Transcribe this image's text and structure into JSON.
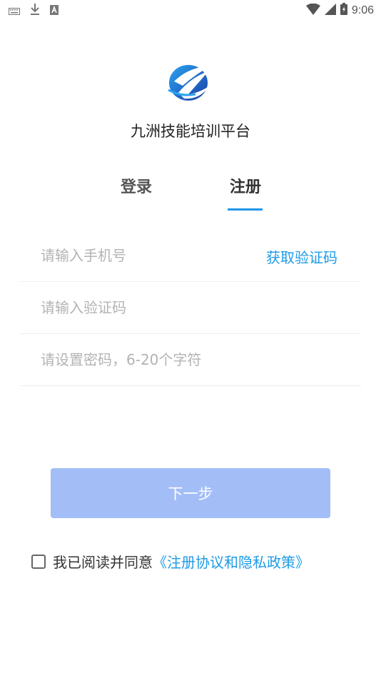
{
  "status_bar": {
    "time": "9:06",
    "left_icons": [
      "keyboard-icon",
      "download-icon",
      "text-a-icon"
    ],
    "right_icons": [
      "wifi-icon",
      "signal-icon",
      "battery-icon"
    ]
  },
  "app": {
    "name": "九洲技能培训平台"
  },
  "tabs": [
    {
      "label": "登录",
      "active": false
    },
    {
      "label": "注册",
      "active": true
    }
  ],
  "form": {
    "phone_placeholder": "请输入手机号",
    "get_code_label": "获取验证码",
    "code_placeholder": "请输入验证码",
    "password_placeholder": "请设置密码，6-20个字符"
  },
  "next_button": {
    "label": "下一步"
  },
  "agreement": {
    "text": "我已阅读并同意",
    "link": "《注册协议和隐私政策》",
    "checked": false
  },
  "colors": {
    "accent": "#1e9be6",
    "button_disabled": "#a3bdf7"
  }
}
